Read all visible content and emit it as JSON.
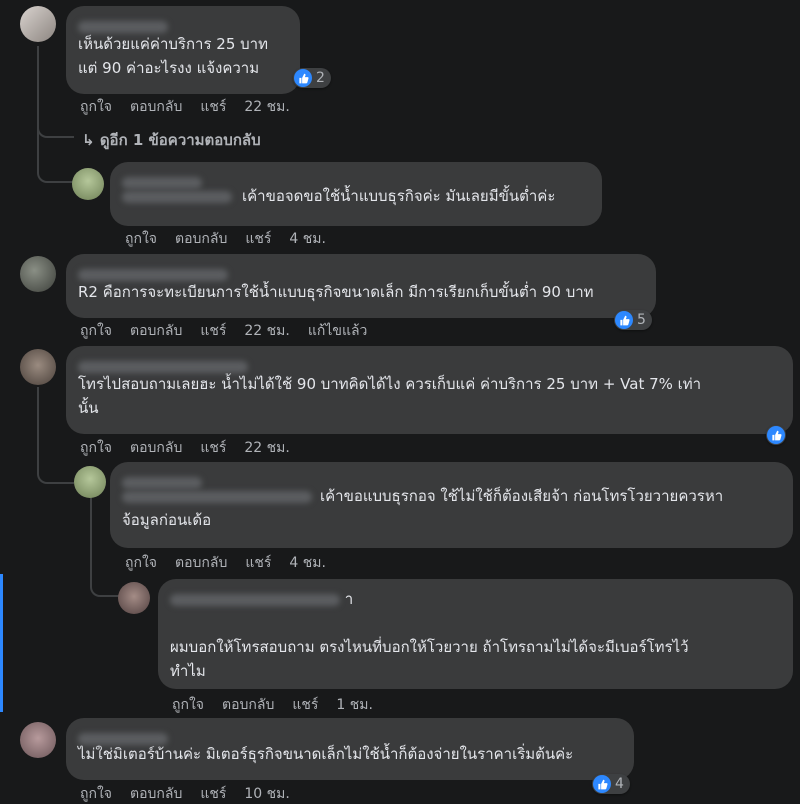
{
  "actions": {
    "like": "ถูกใจ",
    "reply": "ตอบกลับ",
    "share": "แชร์"
  },
  "comments": [
    {
      "text": "เห็นด้วยแค่ค่าบริการ 25 บาท\nแต่ 90 ค่าอะไรงง แจ้งความ",
      "time": "22 ชม.",
      "reactions": "2"
    },
    {
      "text": "เค้าขอจดขอใช้น้ำแบบธุรกิจค่ะ มันเลยมีขั้นต่ำค่ะ",
      "time": "4 ชม."
    },
    {
      "text": "R2 คือการจะทะเบียนการใช้น้ำแบบธุรกิจขนาดเล็ก มีการเรียกเก็บขั้นต่ำ 90 บาท",
      "time": "22 ชม.",
      "edited": "แก้ไขแล้ว",
      "reactions": "5"
    },
    {
      "text": "โทรไปสอบถามเลยฮะ น้ำไม่ได้ใช้ 90 บาทคิดได้ไง ควรเก็บแค่ ค่าบริการ 25 บาท + Vat 7% เท่า\nนั้น",
      "time": "22 ชม."
    },
    {
      "text": "เค้าขอแบบธุรกอจ ใช้ไม่ใช้ก็ต้องเสียจ้า ก่อนโทรโวยวายควรหา\nจ้อมูลก่อนเด้อ",
      "time": "4 ชม."
    },
    {
      "name_tail": "า",
      "text": "ผมบอกให้โทรสอบถาม ตรงไหนที่บอกให้โวยวาย ถ้าโทรถามไม่ได้จะมีเบอร์โทรไว้\nทำไม",
      "time": "1 ชม."
    },
    {
      "text": "ไม่ใช่มิเตอร์บ้านค่ะ มิเตอร์ธุรกิจขนาดเล็กไม่ใช้น้ำก็ต้องจ่ายในราคาเริ่มต้นค่ะ",
      "time": "10 ชม.",
      "reactions": "4"
    }
  ],
  "view_more": "ดูอีก 1 ข้อความตอบกลับ",
  "colors": {
    "background": "#18191a",
    "bubble": "#3a3b3c",
    "like": "#2d88ff",
    "text": "#e4e6eb",
    "muted": "#b0b3b8"
  }
}
